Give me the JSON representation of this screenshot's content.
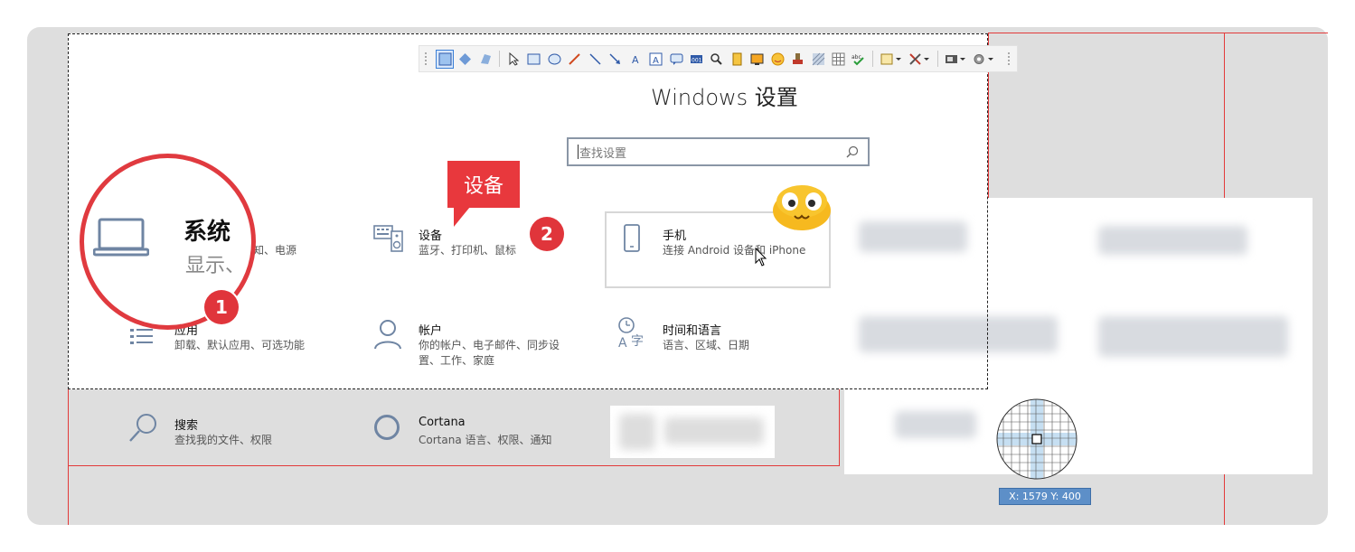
{
  "window": {
    "title": "Windows 设置"
  },
  "search": {
    "placeholder": "查找设置"
  },
  "tiles": [
    {
      "id": "system",
      "title": "系统",
      "desc": "显示、",
      "desc_tail": "知、电源"
    },
    {
      "id": "devices",
      "title": "设备",
      "desc": "蓝牙、打印机、鼠标"
    },
    {
      "id": "phone",
      "title": "手机",
      "desc": "连接 Android 设备和 iPhone"
    },
    {
      "id": "apps",
      "title": "应用",
      "desc": "卸载、默认应用、可选功能"
    },
    {
      "id": "accounts",
      "title": "帐户",
      "desc_line1": "你的帐户、电子邮件、同步设",
      "desc_line2": "置、工作、家庭"
    },
    {
      "id": "time",
      "title": "时间和语言",
      "desc": "语言、区域、日期"
    },
    {
      "id": "search",
      "title": "搜索",
      "desc": "查找我的文件、权限"
    },
    {
      "id": "cortana",
      "title": "Cortana",
      "desc": "Cortana 语言、权限、通知"
    }
  ],
  "annotations": {
    "callout_text": "设备",
    "badge_1": "1",
    "badge_2": "2"
  },
  "status": {
    "coordinates": "X: 1579 Y: 400"
  },
  "toolbar_icons": [
    "rect-select-icon",
    "ellipse-select-icon",
    "free-select-icon",
    "pointer-icon",
    "rectangle-icon",
    "ellipse-icon",
    "pen-icon",
    "line-icon",
    "arrow-icon",
    "text-icon",
    "text-box-icon",
    "comment-icon",
    "number-icon",
    "magnifier-icon",
    "highlight-icon",
    "image-icon",
    "emoji-icon",
    "stamp-icon",
    "mosaic-icon",
    "grid-icon",
    "spell-icon",
    "edit-menu-icon",
    "tools-menu-icon",
    "screen-menu-icon",
    "settings-menu-icon"
  ],
  "colors": {
    "accent_red": "#e23a3a",
    "coord_bg": "#5d8fc8"
  }
}
